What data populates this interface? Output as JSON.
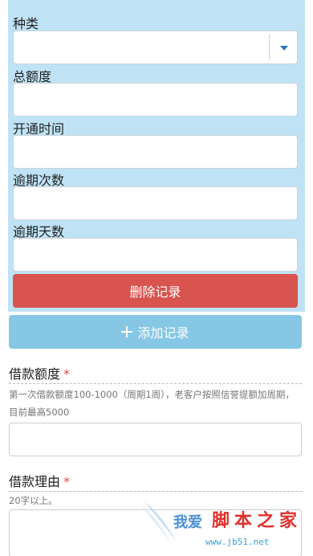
{
  "record": {
    "fields": [
      {
        "label": "种类",
        "value": ""
      },
      {
        "label": "总额度",
        "value": ""
      },
      {
        "label": "开通时间",
        "value": ""
      },
      {
        "label": "逾期次数",
        "value": ""
      },
      {
        "label": "逾期天数",
        "value": ""
      }
    ],
    "delete_label": "删除记录",
    "add_label": "添加记录"
  },
  "loan_amount": {
    "title": "借款额度",
    "required_mark": "*",
    "hint": "第一次借款额度100-1000（周期1周），老客户按照信誉提额加周期，目前最高5000",
    "value": ""
  },
  "loan_reason": {
    "title": "借款理由",
    "required_mark": "*",
    "hint": "20字以上。",
    "value": ""
  },
  "watermark": {
    "text1": "我爱",
    "text2": "脚本之家",
    "url": "www.jb51.net"
  },
  "colors": {
    "panel_bg": "#bfe3f5",
    "delete_bg": "#d9534f",
    "add_bg": "#86c7e6",
    "required": "#d9534f"
  }
}
